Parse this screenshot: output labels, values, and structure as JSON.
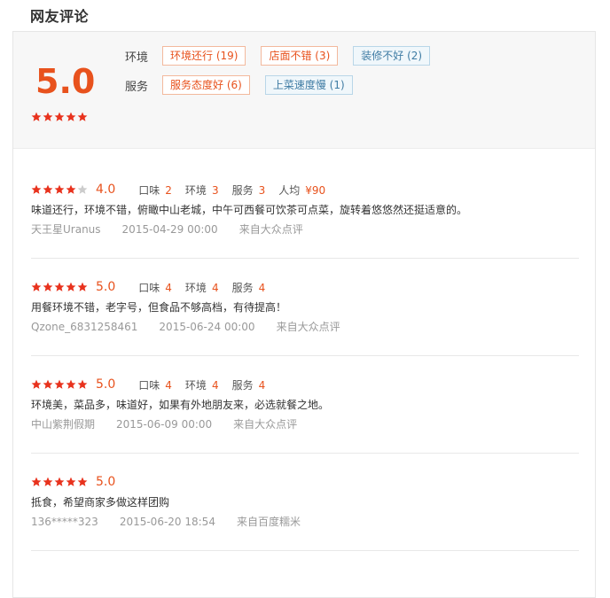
{
  "section_title": "网友评论",
  "summary": {
    "score": "5.0",
    "stars": 5,
    "rows": [
      {
        "label": "环境",
        "tags": [
          {
            "text": "环境还行 (19)",
            "type": "positive"
          },
          {
            "text": "店面不错 (3)",
            "type": "positive"
          },
          {
            "text": "装修不好 (2)",
            "type": "negative"
          }
        ]
      },
      {
        "label": "服务",
        "tags": [
          {
            "text": "服务态度好 (6)",
            "type": "positive"
          },
          {
            "text": "上菜速度慢 (1)",
            "type": "negative"
          }
        ]
      }
    ]
  },
  "reviews": [
    {
      "stars": 4,
      "score": "4.0",
      "subs": [
        {
          "label": "口味",
          "value": "2"
        },
        {
          "label": "环境",
          "value": "3"
        },
        {
          "label": "服务",
          "value": "3"
        },
        {
          "label": "人均",
          "value": "¥90"
        }
      ],
      "text": "味道还行，环境不错，俯瞰中山老城，中午可西餐可饮茶可点菜，旋转着悠悠然还挺适意的。",
      "user": "天王星Uranus",
      "time": "2015-04-29 00:00",
      "source": "来自大众点评"
    },
    {
      "stars": 5,
      "score": "5.0",
      "subs": [
        {
          "label": "口味",
          "value": "4"
        },
        {
          "label": "环境",
          "value": "4"
        },
        {
          "label": "服务",
          "value": "4"
        }
      ],
      "text": "用餐环境不错，老字号，但食品不够高档，有待提高！",
      "user": "Qzone_6831258461",
      "time": "2015-06-24 00:00",
      "source": "来自大众点评"
    },
    {
      "stars": 5,
      "score": "5.0",
      "subs": [
        {
          "label": "口味",
          "value": "4"
        },
        {
          "label": "环境",
          "value": "4"
        },
        {
          "label": "服务",
          "value": "4"
        }
      ],
      "text": "环境美，菜品多，味道好，如果有外地朋友来，必选就餐之地。",
      "user": "中山紫荆假期",
      "time": "2015-06-09 00:00",
      "source": "来自大众点评"
    },
    {
      "stars": 5,
      "score": "5.0",
      "subs": [],
      "text": "抵食，希望商家多做这样团购",
      "user": "136*****323",
      "time": "2015-06-20 18:54",
      "source": "来自百度糯米"
    }
  ],
  "colors": {
    "accent": "#e8521d",
    "star_on": "#e8321d",
    "star_off": "#cccccc",
    "neg_tag": "#3f7ca4"
  }
}
